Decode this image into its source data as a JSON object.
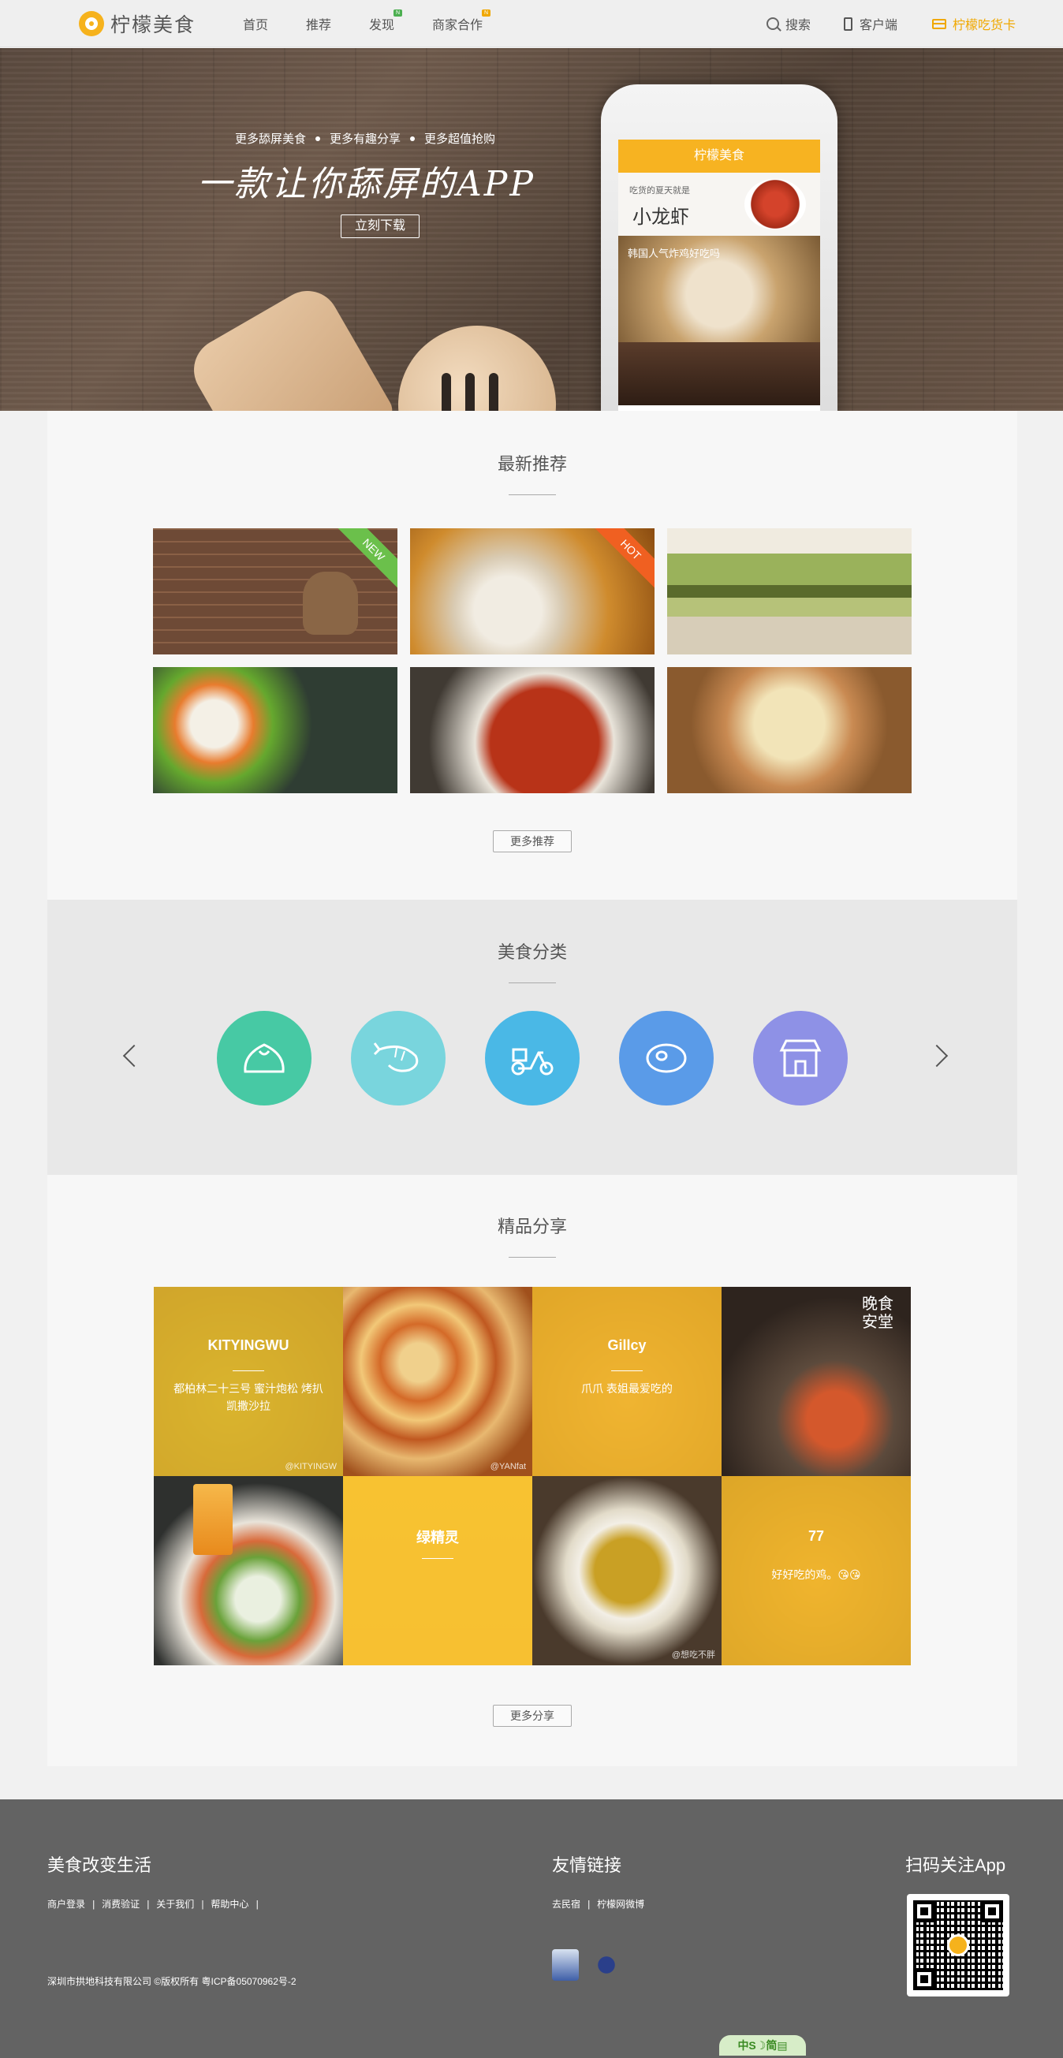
{
  "header": {
    "logo_text": "柠檬美食",
    "nav": [
      {
        "label": "首页",
        "badge": ""
      },
      {
        "label": "推荐",
        "badge": ""
      },
      {
        "label": "发现",
        "badge": "N"
      },
      {
        "label": "商家合作",
        "badge": "N"
      }
    ],
    "search_label": "搜索",
    "client_label": "客户端",
    "card_label": "柠檬吃货卡",
    "accent": "#f0a800"
  },
  "hero": {
    "tags": [
      "更多舔屏美食",
      "更多有趣分享",
      "更多超值抢购"
    ],
    "title": "一款让你舔屏的APP",
    "download_label": "立刻下载",
    "phone": {
      "app_title": "柠檬美食",
      "card1_line1": "吃货的夏天就是",
      "card1_line2": "小龙虾",
      "card2_text": "韩国人气炸鸡好吃吗"
    }
  },
  "recommend": {
    "title": "最新推荐",
    "ribbons": {
      "new": "NEW",
      "hot": "HOT"
    },
    "more_label": "更多推荐"
  },
  "categories": {
    "title": "美食分类",
    "items": [
      {
        "icon": "bun-icon",
        "color": "#47c9a4"
      },
      {
        "icon": "shrimp-icon",
        "color": "#79d5dd"
      },
      {
        "icon": "scooter-icon",
        "color": "#4ab8e6"
      },
      {
        "icon": "steak-icon",
        "color": "#5a9be8"
      },
      {
        "icon": "shop-icon",
        "color": "#8e91e6"
      }
    ]
  },
  "shares": {
    "title": "精品分享",
    "items": [
      {
        "name": "KITYINGWU",
        "desc": "都柏林二十三号 蜜汁炮松 烤扒凯撒沙拉",
        "watermark": "@KITYINGW"
      },
      {
        "name": "",
        "desc": "",
        "watermark": "@YANfat"
      },
      {
        "name": "Gillcy",
        "desc": "爪爪 表姐最爱吃的",
        "watermark": ""
      },
      {
        "name": "",
        "desc": "",
        "watermark": ""
      },
      {
        "name": "",
        "desc": "",
        "watermark": ""
      },
      {
        "name": "绿精灵",
        "desc": "",
        "watermark": ""
      },
      {
        "name": "",
        "desc": "",
        "watermark": "@想吃不胖"
      },
      {
        "name": "77",
        "desc": "好好吃的鸡。😘😘",
        "watermark": ""
      }
    ],
    "more_label": "更多分享",
    "overlay_color": "#f8c02a"
  },
  "footer": {
    "col1_title": "美食改变生活",
    "col1_links": [
      "商户登录",
      "消费验证",
      "关于我们",
      "帮助中心"
    ],
    "col2_title": "友情链接",
    "col2_links": [
      "去民宿",
      "柠檬网微博"
    ],
    "col3_title": "扫码关注App",
    "copyright": "深圳市拱地科技有限公司 ©版权所有 粤ICP备05070962号-2",
    "badge_text": "中S☽简▤"
  }
}
